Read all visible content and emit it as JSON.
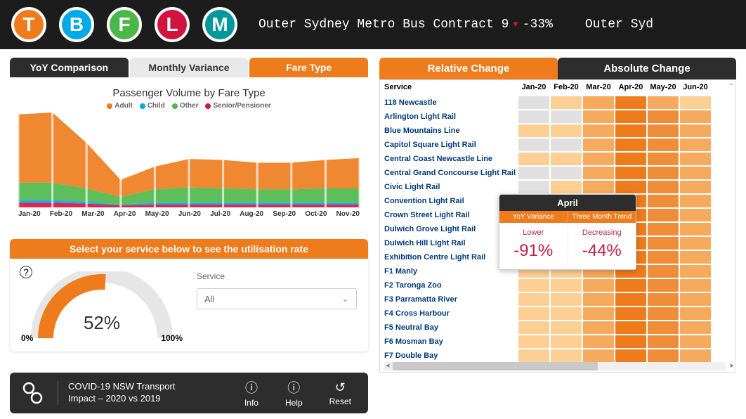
{
  "colors": {
    "orange": "#ee7b1c",
    "blue": "#00a9e7",
    "green": "#4bb748",
    "red": "#d1143d",
    "grey": "#9e9e9e"
  },
  "topbar": {
    "modes": [
      {
        "letter": "T",
        "color": "#ee7b1c",
        "name": "train"
      },
      {
        "letter": "B",
        "color": "#00a9e7",
        "name": "bus"
      },
      {
        "letter": "F",
        "color": "#4bb748",
        "name": "ferry"
      },
      {
        "letter": "L",
        "color": "#d1143d",
        "name": "lightrail"
      },
      {
        "letter": "M",
        "color": "#009999",
        "name": "metro"
      }
    ],
    "ticker1_text": "Outer Sydney Metro Bus Contract 9",
    "ticker1_change": "-33%",
    "ticker2_text": "Outer Syd"
  },
  "tabs_left": {
    "t1": "YoY Comparison",
    "t2": "Monthly Variance",
    "t3": "Fare Type"
  },
  "chart_title": "Passenger Volume by Fare Type",
  "legend": {
    "adult": "Adult",
    "child": "Child",
    "other": "Other",
    "senior": "Senior/Pensioner"
  },
  "chart_data": {
    "type": "area",
    "title": "Passenger Volume by Fare Type",
    "categories": [
      "Jan-20",
      "Feb-20",
      "Mar-20",
      "Apr-20",
      "May-20",
      "Jun-20",
      "Jul-20",
      "Aug-20",
      "Sep-20",
      "Oct-20",
      "Nov-20"
    ],
    "series": [
      {
        "name": "Senior/Pensioner",
        "color": "#d1143d",
        "values": [
          5,
          5,
          4,
          2,
          3,
          3,
          3,
          3,
          3,
          3,
          3
        ]
      },
      {
        "name": "Child",
        "color": "#00a9e7",
        "values": [
          3,
          3,
          2,
          1,
          2,
          2,
          2,
          2,
          2,
          2,
          2
        ]
      },
      {
        "name": "Other",
        "color": "#4bb748",
        "values": [
          18,
          18,
          14,
          8,
          14,
          16,
          15,
          14,
          14,
          15,
          15
        ]
      },
      {
        "name": "Adult",
        "color": "#ee7b1c",
        "values": [
          72,
          74,
          48,
          18,
          24,
          30,
          30,
          28,
          28,
          30,
          32
        ]
      }
    ],
    "ylim": [
      0,
      100
    ],
    "xlabel": "",
    "ylabel": ""
  },
  "util": {
    "header": "Select your service below to see the utilisation rate",
    "min": "0%",
    "max": "100%",
    "value_pct": 52,
    "value_label": "52%",
    "service_label": "Service",
    "service_value": "All"
  },
  "right_tabs": {
    "rel": "Relative Change",
    "abs": "Absolute Change"
  },
  "heatmap": {
    "service_header": "Service",
    "months": [
      "Jan-20",
      "Feb-20",
      "Mar-20",
      "Apr-20",
      "May-20",
      "Jun-20"
    ],
    "rows": [
      {
        "name": "118 Newcastle",
        "cells": [
          "#e0e0e0",
          "#fccf94",
          "#f6aa5d",
          "#ee7b1c",
          "#f6aa5d",
          "#fccf94"
        ]
      },
      {
        "name": "Arlington Light Rail",
        "cells": [
          "#e0e0e0",
          "#e0e0e0",
          "#f6aa5d",
          "#ee7b1c",
          "#f08d39",
          "#f6aa5d"
        ]
      },
      {
        "name": "Blue Mountains Line",
        "cells": [
          "#fccf94",
          "#fccf94",
          "#f6aa5d",
          "#ee7b1c",
          "#f08d39",
          "#f6aa5d"
        ]
      },
      {
        "name": "Capitol Square Light Rail",
        "cells": [
          "#e0e0e0",
          "#e0e0e0",
          "#f6aa5d",
          "#ee7b1c",
          "#f08d39",
          "#f6aa5d"
        ]
      },
      {
        "name": "Central Coast Newcastle Line",
        "cells": [
          "#fccf94",
          "#fccf94",
          "#f6aa5d",
          "#ee7b1c",
          "#f08d39",
          "#f6aa5d"
        ]
      },
      {
        "name": "Central Grand Concourse Light Rail",
        "cells": [
          "#e0e0e0",
          "#e0e0e0",
          "#f6aa5d",
          "#ee7b1c",
          "#f08d39",
          "#f6aa5d"
        ]
      },
      {
        "name": "Civic Light Rail",
        "cells": [
          "#e0e0e0",
          "#fccf94",
          "#f6aa5d",
          "#ee7b1c",
          "#f08d39",
          "#f6aa5d"
        ]
      },
      {
        "name": "Convention Light Rail",
        "cells": [
          "#e0e0e0",
          "#e0e0e0",
          "#f6aa5d",
          "#ee7b1c",
          "#f08d39",
          "#f6aa5d"
        ]
      },
      {
        "name": "Crown Street Light Rail",
        "cells": [
          "#e0e0e0",
          "#e0e0e0",
          "#f6aa5d",
          "#ee7b1c",
          "#f08d39",
          "#f6aa5d"
        ]
      },
      {
        "name": "Dulwich Grove Light Rail",
        "cells": [
          "#e0e0e0",
          "#e0e0e0",
          "#f6aa5d",
          "#ee7b1c",
          "#f08d39",
          "#f6aa5d"
        ]
      },
      {
        "name": "Dulwich Hill Light Rail",
        "cells": [
          "#e0e0e0",
          "#e0e0e0",
          "#f6aa5d",
          "#ee7b1c",
          "#f08d39",
          "#f6aa5d"
        ]
      },
      {
        "name": "Exhibition Centre Light Rail",
        "cells": [
          "#e0e0e0",
          "#e0e0e0",
          "#f6aa5d",
          "#ee7b1c",
          "#f08d39",
          "#f6aa5d"
        ]
      },
      {
        "name": "F1 Manly",
        "cells": [
          "#fccf94",
          "#fccf94",
          "#f6aa5d",
          "#ee7b1c",
          "#f08d39",
          "#f6aa5d"
        ]
      },
      {
        "name": "F2 Taronga Zoo",
        "cells": [
          "#fccf94",
          "#fccf94",
          "#f6aa5d",
          "#ee7b1c",
          "#f08d39",
          "#f6aa5d"
        ]
      },
      {
        "name": "F3 Parramatta River",
        "cells": [
          "#fccf94",
          "#fccf94",
          "#f6aa5d",
          "#ee7b1c",
          "#f08d39",
          "#f6aa5d"
        ]
      },
      {
        "name": "F4 Cross Harbour",
        "cells": [
          "#fccf94",
          "#fccf94",
          "#f6aa5d",
          "#ee7b1c",
          "#f08d39",
          "#f6aa5d"
        ]
      },
      {
        "name": "F5 Neutral Bay",
        "cells": [
          "#fccf94",
          "#fccf94",
          "#f6aa5d",
          "#ee7b1c",
          "#f08d39",
          "#f6aa5d"
        ]
      },
      {
        "name": "F6 Mosman Bay",
        "cells": [
          "#fccf94",
          "#fccf94",
          "#f6aa5d",
          "#ee7b1c",
          "#f08d39",
          "#f6aa5d"
        ]
      },
      {
        "name": "F7 Double Bay",
        "cells": [
          "#fccf94",
          "#fccf94",
          "#f6aa5d",
          "#ee7b1c",
          "#f08d39",
          "#f6aa5d"
        ]
      }
    ]
  },
  "tooltip": {
    "month": "April",
    "col1_header": "YoY Variance",
    "col2_header": "Three Month Trend",
    "col1_label": "Lower",
    "col1_value": "-91%",
    "col2_label": "Decreasing",
    "col2_value": "-44%"
  },
  "footer": {
    "title_line1": "COVID-19 NSW Transport",
    "title_line2": "Impact – 2020 vs 2019",
    "info": "Info",
    "help": "Help",
    "reset": "Reset"
  }
}
